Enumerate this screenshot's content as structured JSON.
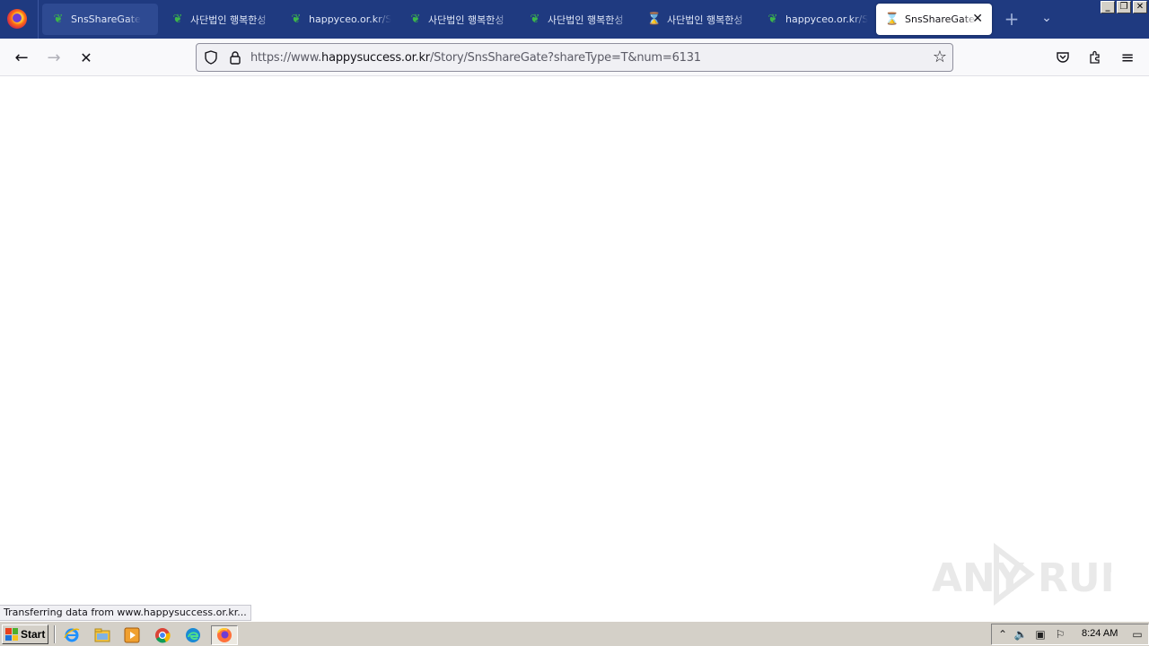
{
  "browser": {
    "tabs": [
      {
        "title": "SnsShareGate",
        "icon": "leaf-icon",
        "state": "hover"
      },
      {
        "title": "사단법인 행복한성",
        "icon": "leaf-icon",
        "state": "normal"
      },
      {
        "title": "happyceo.or.kr/Sto",
        "icon": "leaf-icon",
        "state": "normal"
      },
      {
        "title": "사단법인 행복한성",
        "icon": "leaf-icon",
        "state": "normal"
      },
      {
        "title": "사단법인 행복한성",
        "icon": "leaf-icon",
        "state": "normal"
      },
      {
        "title": "사단법인 행복한성",
        "icon": "hourglass-icon",
        "state": "normal"
      },
      {
        "title": "happyceo.or.kr/Sto",
        "icon": "leaf-icon",
        "state": "normal"
      },
      {
        "title": "SnsShareGate",
        "icon": "hourglass-icon",
        "state": "active"
      }
    ],
    "url": {
      "prefix": "https://www.",
      "host": "happysuccess.or.kr",
      "path": "/Story/SnsShareGate?shareType=T&num=6131"
    },
    "status_text": "Transferring data from www.happysuccess.or.kr..."
  },
  "watermark": {
    "text_left": "ANY",
    "text_right": "RUN"
  },
  "taskbar": {
    "start_label": "Start",
    "clock": "8:24 AM",
    "apps": [
      "ie-icon",
      "explorer-icon",
      "media-player-icon",
      "chrome-icon",
      "edge-icon",
      "firefox-icon"
    ]
  },
  "colors": {
    "tabbar": "#1f3a80",
    "accent_leaf": "#3cb44b",
    "taskbar": "#d4d0c8"
  }
}
